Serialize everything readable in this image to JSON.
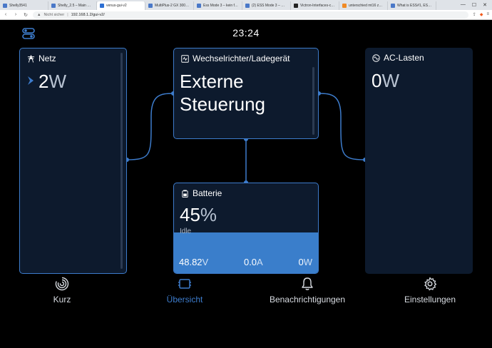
{
  "browser": {
    "tabs": [
      {
        "label": "Shelly3541",
        "fav": "blue"
      },
      {
        "label": "Shelly_2.5 – Main Menu",
        "fav": "blue"
      },
      {
        "label": "venus-gui-v2",
        "fav": "blue2",
        "active": true
      },
      {
        "label": "MultiPlus-2 GX 3000 – Vict…",
        "fav": "blue"
      },
      {
        "label": "Ess Mode 3 – kein feed in …",
        "fav": "blue"
      },
      {
        "label": "(2) ESS Mode 3 – Grid Set…",
        "fav": "blue"
      },
      {
        "label": "Victron-Interfaces-code/…",
        "fav": "dark"
      },
      {
        "label": "unterschied mt16 zu unit …",
        "fav": "orange"
      },
      {
        "label": "What is ESS#1, ESS#2? – …",
        "fav": "blue"
      }
    ],
    "security_label": "Nicht sicher",
    "url": "192.168.1.2/gui-v2/"
  },
  "header": {
    "time": "23:24"
  },
  "grid": {
    "title": "Netz",
    "value": "2",
    "unit": "W"
  },
  "inverter": {
    "title": "Wechselrichter/Ladegerät",
    "mode": "Externe Steuerung"
  },
  "ac_loads": {
    "title": "AC-Lasten",
    "value": "0",
    "unit": "W"
  },
  "battery": {
    "title": "Batterie",
    "soc": "45",
    "soc_unit": "%",
    "soc_fraction": 0.45,
    "state": "Idle",
    "voltage": "48.82",
    "voltage_unit": "V",
    "current": "0.0",
    "current_unit": "A",
    "power": "0",
    "power_unit": "W"
  },
  "nav": {
    "kurz": "Kurz",
    "uebersicht": "Übersicht",
    "benachrichtigungen": "Benachrichtigungen",
    "einstellungen": "Einstellungen"
  },
  "colors": {
    "accent": "#3d7ccc",
    "panel_bg": "#0d1a2d",
    "battery_fill": "#3a7ecb",
    "background": "#000000"
  }
}
